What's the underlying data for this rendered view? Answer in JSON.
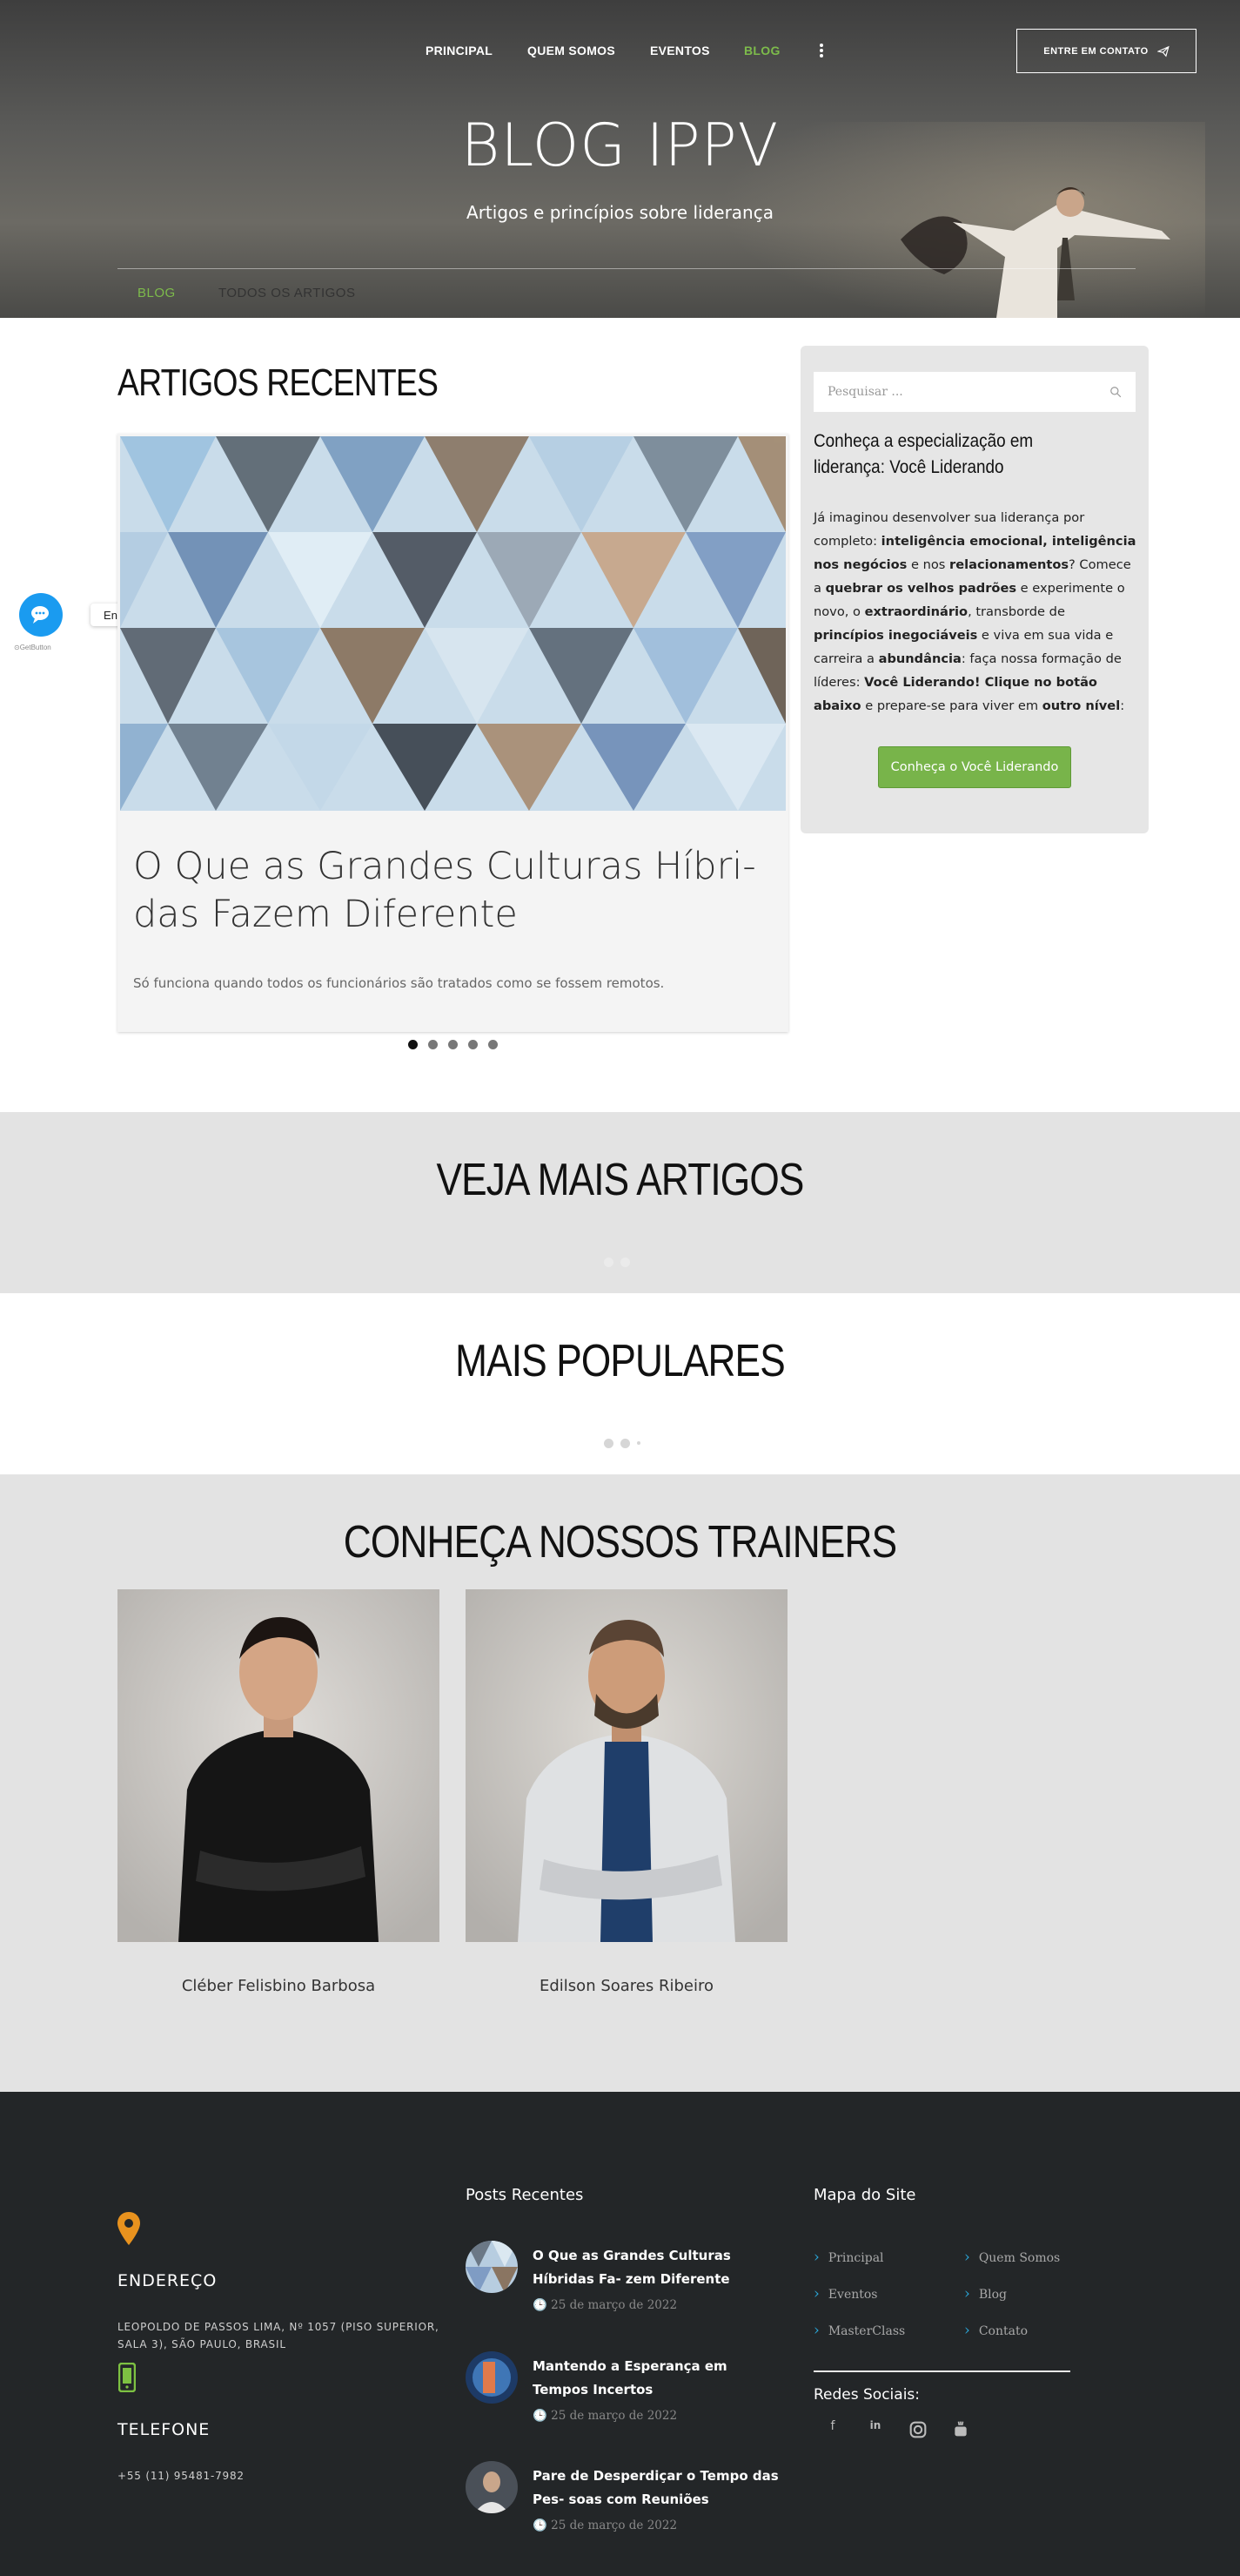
{
  "nav": {
    "items": [
      "PRINCIPAL",
      "QUEM SOMOS",
      "EVENTOS",
      "BLOG"
    ],
    "active": "BLOG",
    "contact_button": "ENTRE EM CONTATO"
  },
  "hero": {
    "title": "BLOG IPPV",
    "subtitle": "Artigos e princípios sobre liderança",
    "tabs": [
      "BLOG",
      "TODOS OS ARTIGOS"
    ]
  },
  "recent": {
    "heading": "ARTIGOS RECENTES",
    "card_title": "O Que as Grandes Culturas Híbri- das Fazem Diferente",
    "card_excerpt": "Só funciona quando todos os funcionários são tratados como se fossem remotos.",
    "slides": 5,
    "active_slide": 1
  },
  "floating": {
    "label": "Entre em Contato",
    "brand": "GetButton",
    "color": "#1a9bf0"
  },
  "sidebar": {
    "search_placeholder": "Pesquisar ...",
    "heading": "Conheça a especialização em liderança: Você Liderando",
    "body_html_parts": [
      "Já imaginou desenvolver sua liderança por completo: ",
      "inteligência emocional, inteligência nos negócios",
      " e nos ",
      "relacionamentos",
      "? Comece a ",
      "quebrar os velhos padrões",
      " e experimente o novo, o ",
      "extraordinário",
      ", transborde de ",
      "princípios inegociáveis",
      " e viva em sua vida e carreira a ",
      "abundância",
      ": faça nossa formação de líderes: ",
      "Você Liderando! Clique no botão abaixo",
      " e prepare-se para viver em ",
      "outro nível",
      ":"
    ],
    "button": "Conheça o Você Liderando",
    "accent": "#78b44a"
  },
  "sections": {
    "more": "VEJA MAIS ARTIGOS",
    "popular": "MAIS POPULARES",
    "trainers": "CONHEÇA NOSSOS TRAINERS"
  },
  "trainers": [
    {
      "name": "Cléber Felisbino Barbosa"
    },
    {
      "name": "Edilson Soares Ribeiro"
    }
  ],
  "footer": {
    "address_label": "ENDEREÇO",
    "address": "LEOPOLDO DE PASSOS LIMA, Nº 1057 (PISO SUPERIOR, SALA 3), SÃO PAULO, BRASIL",
    "phone_label": "TELEFONE",
    "phone": "+55 (11) 95481-7982",
    "posts_heading": "Posts Recentes",
    "posts": [
      {
        "title": "O Que as Grandes Culturas Híbridas Fa- zem Diferente",
        "date": "25 de março de 2022"
      },
      {
        "title": "Mantendo a Esperança em Tempos Incertos",
        "date": "25 de março de 2022"
      },
      {
        "title": "Pare de Desperdiçar o Tempo das Pes- soas com Reuniões",
        "date": "25 de março de 2022"
      }
    ],
    "map_heading": "Mapa do Site",
    "map_links": [
      "Principal",
      "Quem Somos",
      "Eventos",
      "Blog",
      "MasterClass",
      "Contato"
    ],
    "social_heading": "Redes Sociais:",
    "social_icons": [
      "facebook-icon",
      "linkedin-icon",
      "instagram-icon",
      "youtube-icon"
    ],
    "address_icon_color": "#e8921e",
    "phone_icon_color": "#7dc142"
  }
}
